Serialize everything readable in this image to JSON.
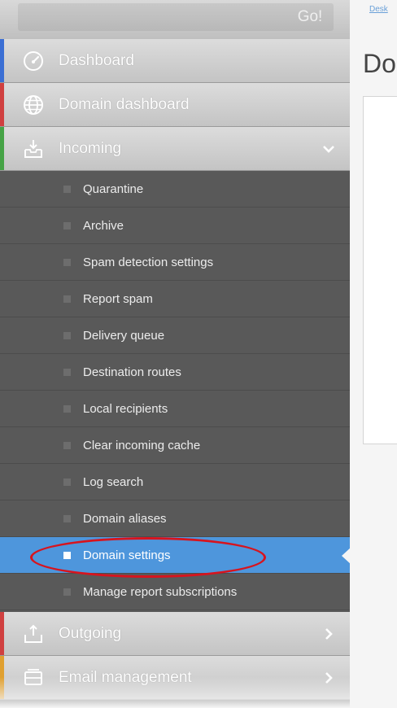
{
  "search": {
    "go_label": "Go!"
  },
  "menu": {
    "dashboard": {
      "label": "Dashboard",
      "accent": "#3b6fd4"
    },
    "domain_dashboard": {
      "label": "Domain dashboard",
      "accent": "#d04040"
    },
    "incoming": {
      "label": "Incoming",
      "accent": "#46a346",
      "items": [
        {
          "label": "Quarantine"
        },
        {
          "label": "Archive"
        },
        {
          "label": "Spam detection settings"
        },
        {
          "label": "Report spam"
        },
        {
          "label": "Delivery queue"
        },
        {
          "label": "Destination routes"
        },
        {
          "label": "Local recipients"
        },
        {
          "label": "Clear incoming cache"
        },
        {
          "label": "Log search"
        },
        {
          "label": "Domain aliases"
        },
        {
          "label": "Domain settings",
          "active": true
        },
        {
          "label": "Manage report subscriptions"
        }
      ]
    },
    "outgoing": {
      "label": "Outgoing",
      "accent": "#d04040"
    },
    "email_management": {
      "label": "Email management",
      "accent": "#e0a030"
    }
  },
  "content": {
    "breadcrumb": "Desk",
    "page_title": "Do"
  },
  "colors": {
    "active_item": "#4e96dc",
    "highlight": "#d7141e"
  }
}
